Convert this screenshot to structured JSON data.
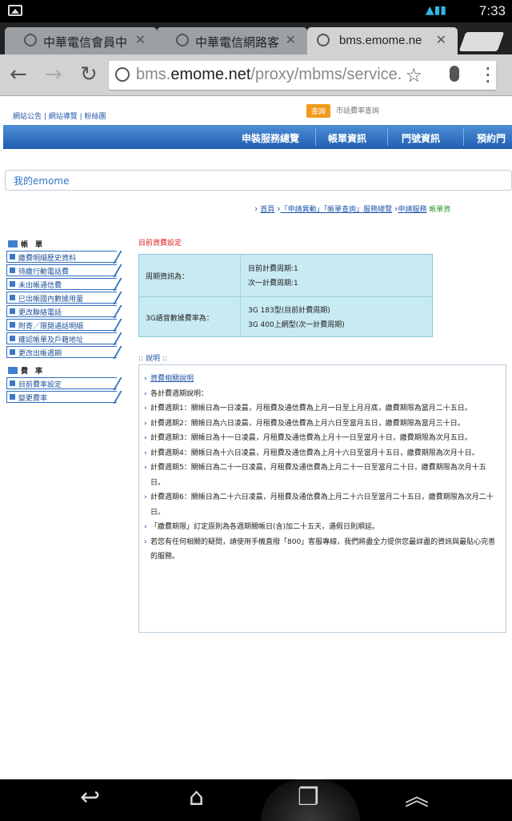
{
  "status_bar": {
    "time": "7:33"
  },
  "tabs": [
    {
      "label": "中華電信會員中"
    },
    {
      "label": "中華電信網路客"
    },
    {
      "label": "bms.emome.ne"
    }
  ],
  "omnibox": {
    "url_prefix": "bms.",
    "url_host": "emome.net",
    "url_path": "/proxy/mbms/service."
  },
  "site": {
    "top_links": "網站公告 | 網站導覽 | 粉絲團",
    "search_button": "查詢",
    "search_label": "市話費率查詢",
    "nav": [
      "申裝服務總覽",
      "帳單資訊",
      "門號資訊",
      "預約門"
    ],
    "my_emome": "我的emome",
    "breadcrumb": {
      "home": "首頁",
      "apply": "「申請異動」「帳單查詢」服務總覽",
      "service": "申請服務",
      "current": "帳單資"
    }
  },
  "left_menu": {
    "bill_title": "帳　單",
    "bill_items": [
      "繳費明細歷史資料",
      "待繳行動電話費",
      "未出帳通信費",
      "已出帳國內數據用量",
      "更改聯絡電話",
      "附寄／限閱通話明細",
      "確認帳單及戶籍地址",
      "更改出帳週期"
    ],
    "rate_title": "費　率",
    "rate_items": [
      "目前費率設定",
      "變更費率"
    ]
  },
  "main": {
    "section_title": "目前資費設定",
    "period_label": "周期資訊為：",
    "period_current": "目前計費周期:1",
    "period_next": "次一計費周期:1",
    "rate_label": "3G語音數據費率為：",
    "rate_current": "3G 183型(目前計費周期)",
    "rate_next": "3G 400上網型(次一計費周期)",
    "desc_title": "說明",
    "desc_items": [
      "資費相關說明",
      "各計費週期說明：",
      "計費週期1：關帳日為一日凌晨，月租費及通信費為上月一日至上月月底，繳費期限為當月二十五日。",
      "計費週期2：關帳日為六日凌晨，月租費及通信費為上月六日至當月五日，繳費期限為當月三十日。",
      "計費週期3：關帳日為十一日凌晨，月租費及通信費為上月十一日至當月十日，繳費期限為次月五日。",
      "計費週期4：關帳日為十六日凌晨，月租費及通信費為上月十六日至當月十五日，繳費期限為次月十日。",
      "計費週期5：關帳日為二十一日凌晨，月租費及通信費為上月二十一日至當月二十日，繳費期限為次月十五日。",
      "計費週期6：關帳日為二十六日凌晨，月租費及通信費為上月二十六日至當月二十五日，繳費期限為次月二十日。",
      "「繳費期限」訂定原則為各週期關帳日(含)加二十五天，遇假日則順延。",
      "若您有任何相關的疑問，請使用手機直撥「800」客服專線，我們將盡全力提供您最詳盡的資訊與最貼心完善的服務。"
    ]
  }
}
